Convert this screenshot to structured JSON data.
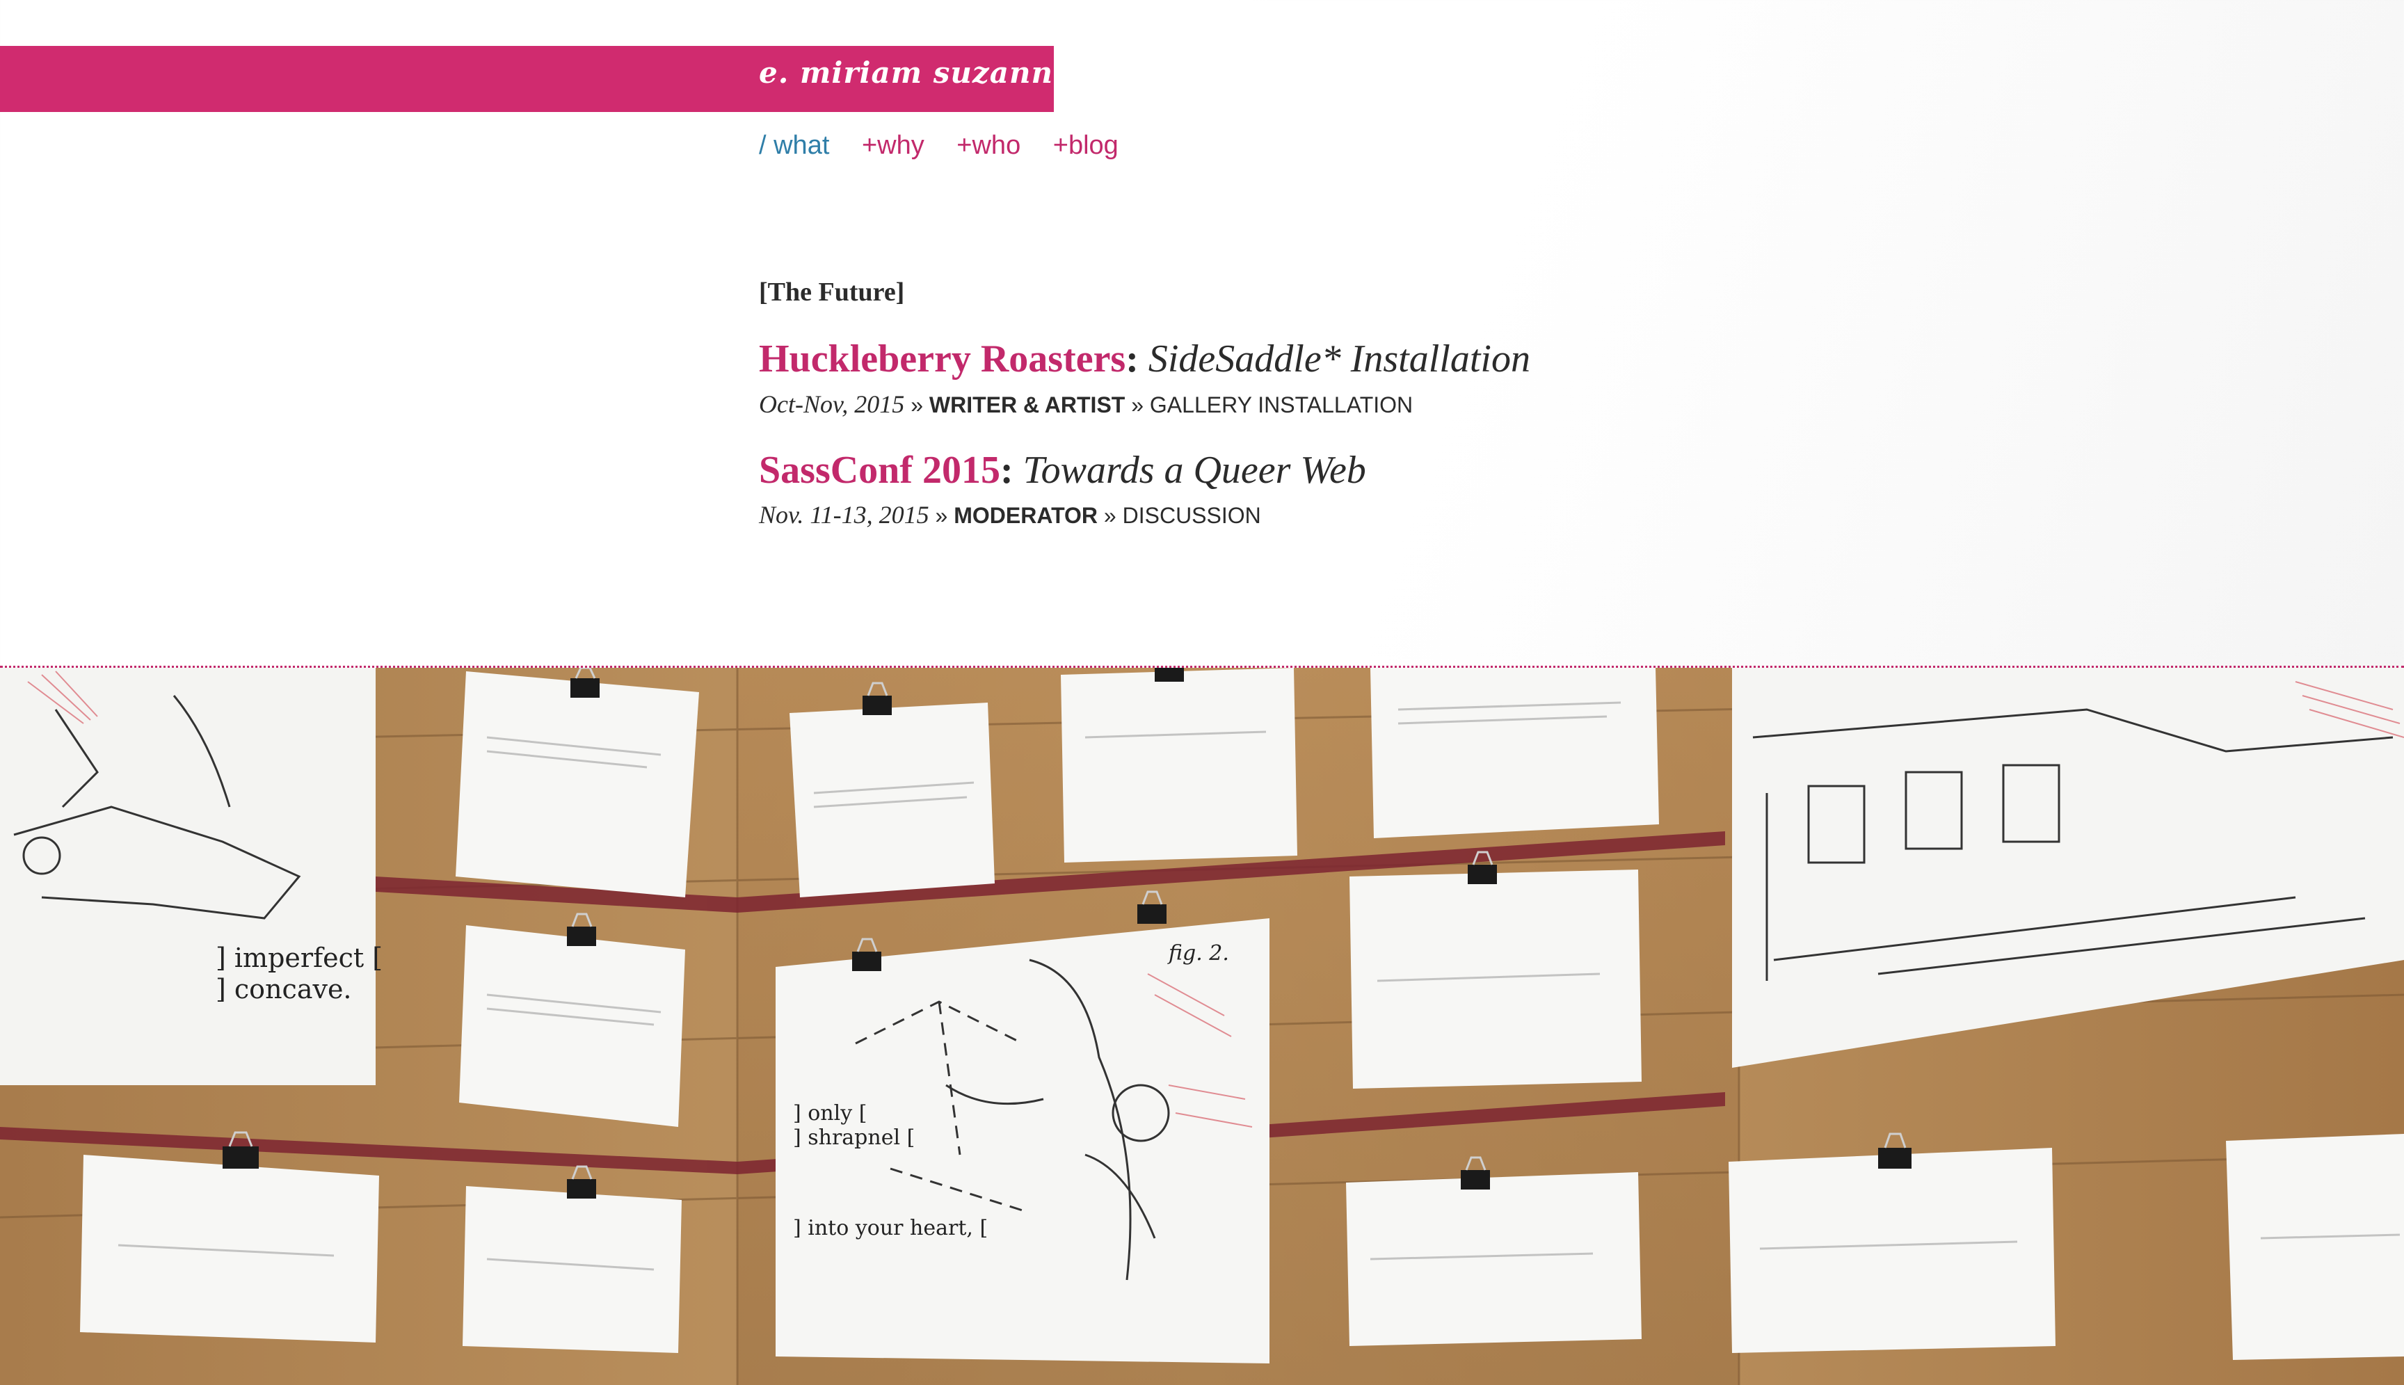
{
  "site": {
    "logo": "e. miriam suzanne"
  },
  "nav": {
    "items": [
      {
        "label": "/ what"
      },
      {
        "label": "+why"
      },
      {
        "label": "+who"
      },
      {
        "label": "+blog"
      }
    ]
  },
  "future": {
    "label": "[The Future]",
    "events": [
      {
        "org": "Huckleberry Roasters",
        "title": "SideSaddle* Installation",
        "date": "Oct-Nov, 2015",
        "sep1": "»",
        "role": "WRITER & ARTIST",
        "sep2": "»",
        "kind": "GALLERY INSTALLATION"
      },
      {
        "org": "SassConf 2015",
        "title": "Towards a Queer Web",
        "date": "Nov. 11-13, 2015",
        "sep1": "»",
        "role": "MODERATOR",
        "sep2": "»",
        "kind": "DISCUSSION"
      }
    ]
  },
  "photo": {
    "card_texts": [
      "] imperfect [",
      "] concave.",
      "] only [",
      "] shrapnel [",
      "] into your heart, [",
      "fig. 2."
    ]
  },
  "colors": {
    "brand": "#d02b6f",
    "link": "#2f7ea8",
    "accent": "#c2296b",
    "wood": "#b88a55"
  }
}
